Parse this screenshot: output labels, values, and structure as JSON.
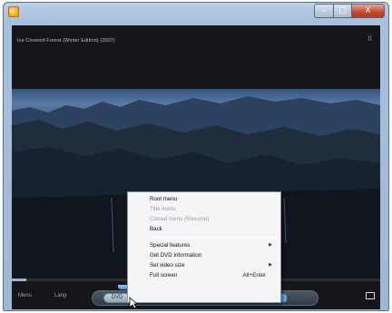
{
  "window": {
    "title": "",
    "buttons": {
      "minimize": "–",
      "maximize": "□",
      "close": "X"
    }
  },
  "player": {
    "video_title": "Ice Covered Forest (Winter Edition) (2007)",
    "corner_icon": "player-menu-icon",
    "seek_progress": 0.04,
    "controls": {
      "left_label": "Menu",
      "second_label": "Lang",
      "pill_button": "DVD",
      "fullscreen_icon": "fullscreen-icon"
    }
  },
  "context_menu": {
    "items": [
      {
        "label": "Root menu",
        "disabled": false
      },
      {
        "label": "Title menu",
        "disabled": true
      },
      {
        "label": "Closed menu (Resume)",
        "disabled": true
      },
      {
        "label": "Back",
        "disabled": false
      },
      {
        "separator": true
      },
      {
        "label": "Special features",
        "disabled": false,
        "submenu": true
      },
      {
        "label": "Get DVD information",
        "disabled": false
      },
      {
        "label": "Set video size",
        "disabled": false,
        "submenu": true
      },
      {
        "label": "Full screen",
        "disabled": false,
        "shortcut": "Alt+Enter"
      }
    ]
  },
  "colors": {
    "menu_background": "#f4f5f7",
    "player_background": "#141619",
    "accent": "#3b8fd6"
  }
}
